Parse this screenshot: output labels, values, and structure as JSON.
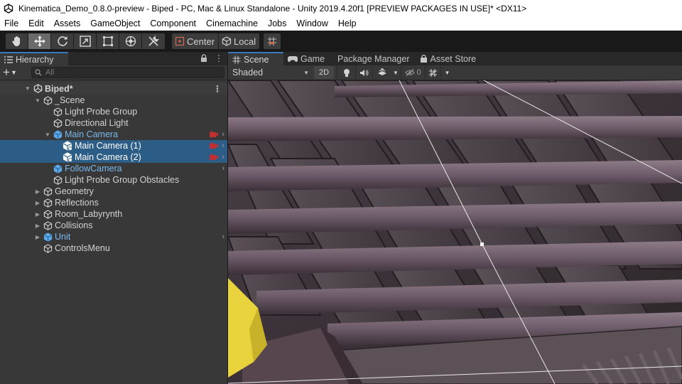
{
  "window": {
    "title": "Kinematica_Demo_0.8.0-preview - Biped - PC, Mac & Linux Standalone - Unity 2019.4.20f1 [PREVIEW PACKAGES IN USE]* <DX11>",
    "app_icon": "unity-logo-icon"
  },
  "menu": [
    "File",
    "Edit",
    "Assets",
    "GameObject",
    "Component",
    "Cinemachine",
    "Jobs",
    "Window",
    "Help"
  ],
  "toolbar": {
    "tools": [
      "hand-tool-icon",
      "move-tool-icon",
      "rotate-tool-icon",
      "scale-tool-icon",
      "rect-tool-icon",
      "transform-tool-icon",
      "custom-tool-icon"
    ],
    "active_tool": "move-tool-icon",
    "pivot_mode": "Center",
    "pivot_rotation": "Local"
  },
  "hierarchy": {
    "tab_label": "Hierarchy",
    "search_placeholder": "All",
    "scene_name": "Biped*",
    "rows": [
      {
        "label": "_Scene",
        "depth": 1,
        "expanded": true,
        "prefab": false
      },
      {
        "label": "Light Probe Group",
        "depth": 2,
        "prefab": false
      },
      {
        "label": "Directional Light",
        "depth": 2,
        "prefab": false
      },
      {
        "label": "Main Camera",
        "depth": 2,
        "expanded": true,
        "prefab": true
      },
      {
        "label": "Main Camera (1)",
        "depth": 3,
        "prefab": false,
        "selected": true
      },
      {
        "label": "Main Camera (2)",
        "depth": 3,
        "prefab": false,
        "selected": true
      },
      {
        "label": "FollowCamera",
        "depth": 2,
        "prefab": true
      },
      {
        "label": "Light Probe Group Obstacles",
        "depth": 2,
        "prefab": false
      },
      {
        "label": "Geometry",
        "depth": 1,
        "expanded": false,
        "prefab": false
      },
      {
        "label": "Reflections",
        "depth": 1,
        "expanded": false,
        "prefab": false
      },
      {
        "label": "Room_Labyrynth",
        "depth": 1,
        "expanded": false,
        "prefab": false
      },
      {
        "label": "Collisions",
        "depth": 1,
        "expanded": false,
        "prefab": false
      },
      {
        "label": "Unit",
        "depth": 1,
        "expanded": false,
        "prefab": true
      },
      {
        "label": "ControlsMenu",
        "depth": 1,
        "prefab": false
      }
    ]
  },
  "scene_view": {
    "tabs": [
      "Scene",
      "Game",
      "Package Manager",
      "Asset Store"
    ],
    "active_tab": "Scene",
    "draw_mode": "Shaded",
    "mode_2d": "2D",
    "hidden_count": "0"
  },
  "colors": {
    "selection": "#2c5d87",
    "prefab_text": "#7ab9ef",
    "accent_tab": "#3a79bb"
  }
}
